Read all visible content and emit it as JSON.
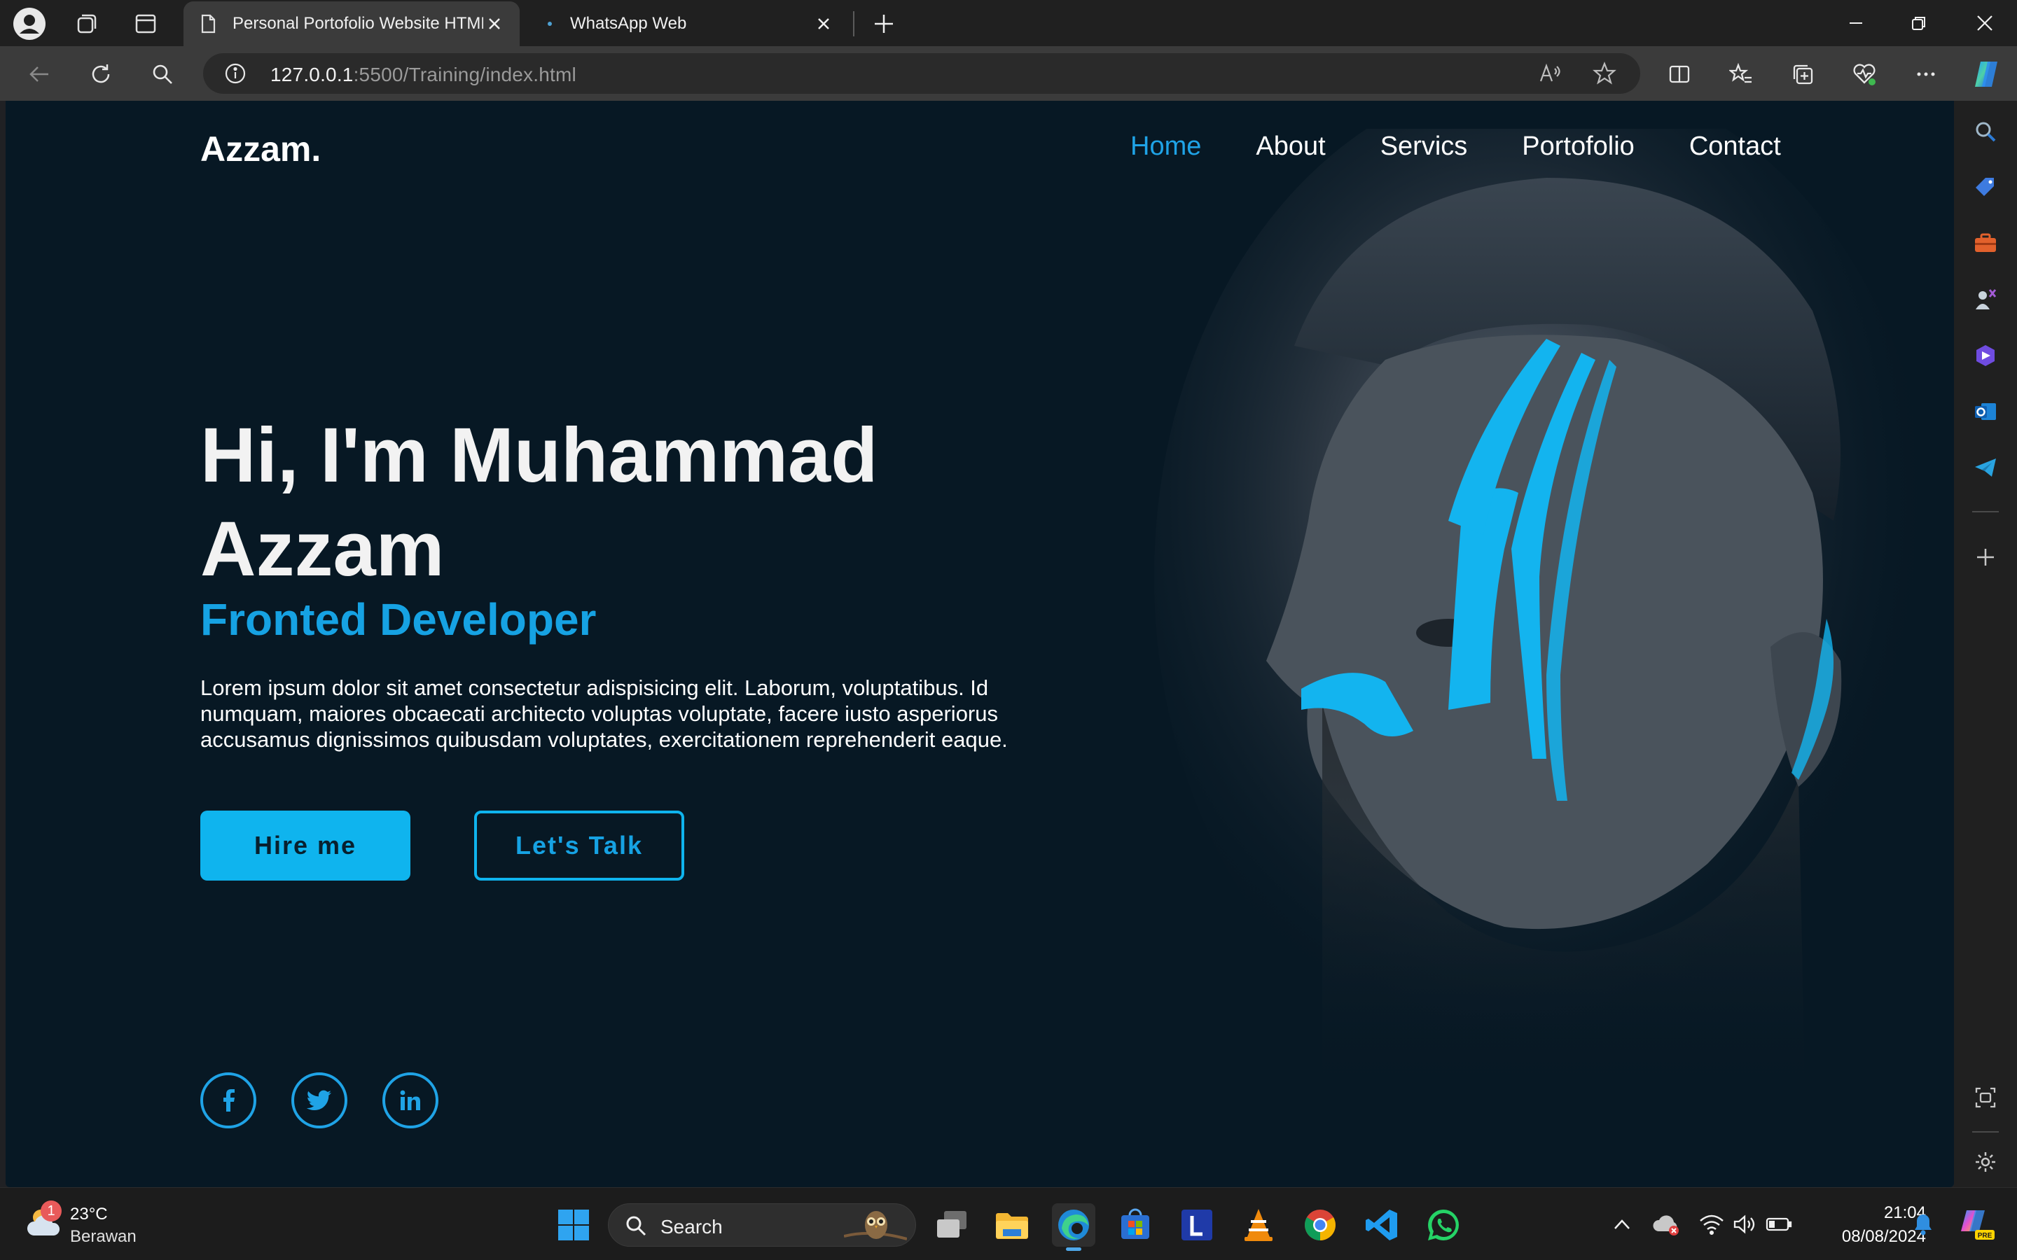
{
  "browser": {
    "tabs": [
      {
        "title": "Personal Portofolio Website HTML",
        "active": true
      },
      {
        "title": "WhatsApp Web",
        "active": false
      }
    ],
    "url_host": "127.0.0.1",
    "url_rest": ":5500/Training/index.html"
  },
  "page": {
    "logo": "Azzam.",
    "nav": [
      "Home",
      "About",
      "Servics",
      "Portofolio",
      "Contact"
    ],
    "hero_title": "Hi, I'm Muhammad Azzam",
    "hero_subtitle": "Fronted Developer",
    "hero_text": "Lorem ipsum dolor sit amet consectetur adispisicing elit. Laborum, voluptatibus. Id numquam, maiores obcaecati architecto voluptas voluptate, facere iusto asperiorus accusamus dignissimos quibusdam voluptates, exercitationem reprehenderit eaque.",
    "hire_label": "Hire me",
    "talk_label": "Let's Talk",
    "social_icons": [
      "facebook-icon",
      "twitter-icon",
      "linkedin-icon"
    ],
    "accent_color": "#1fa3e6",
    "background_color": "#071824"
  },
  "taskbar": {
    "weather_temp": "23°C",
    "weather_desc": "Berawan",
    "weather_badge": "1",
    "search_label": "Search",
    "time": "21:04",
    "date": "08/08/2024"
  }
}
